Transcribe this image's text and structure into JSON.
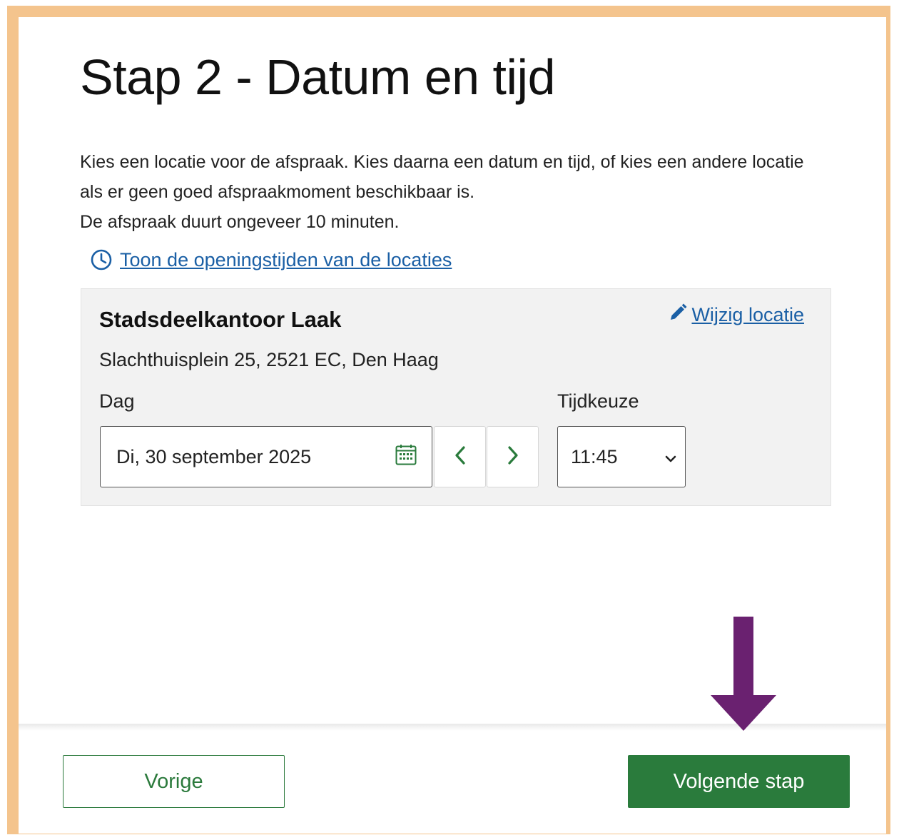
{
  "page": {
    "title": "Stap 2 - Datum en tijd",
    "intro_line1": "Kies een locatie voor de afspraak. Kies daarna een datum en tijd, of kies een andere locatie als er geen goed afspraakmoment beschikbaar is.",
    "intro_line2": "De afspraak duurt ongeveer 10 minuten.",
    "opening_hours_link": "Toon de openingstijden van de locaties"
  },
  "location": {
    "name": "Stadsdeelkantoor Laak",
    "address": "Slachthuisplein 25, 2521 EC, Den Haag",
    "change_link": "Wijzig locatie",
    "day_label": "Dag",
    "day_value": "Di, 30 september 2025",
    "time_label": "Tijdkeuze",
    "time_value": "11:45"
  },
  "footer": {
    "previous_label": "Vorige",
    "next_label": "Volgende stap"
  },
  "colors": {
    "frame": "#f4c48d",
    "link": "#1a5fa5",
    "primary_green": "#2a7b3c",
    "annotation_arrow": "#6a2170"
  },
  "icons": {
    "opening_hours": "clock-icon",
    "change_location": "pencil-icon",
    "date_picker": "calendar-icon",
    "previous_day": "chevron-left-icon",
    "next_day": "chevron-right-icon",
    "time_dropdown": "chevron-down-icon",
    "annotation": "down-arrow-icon"
  }
}
